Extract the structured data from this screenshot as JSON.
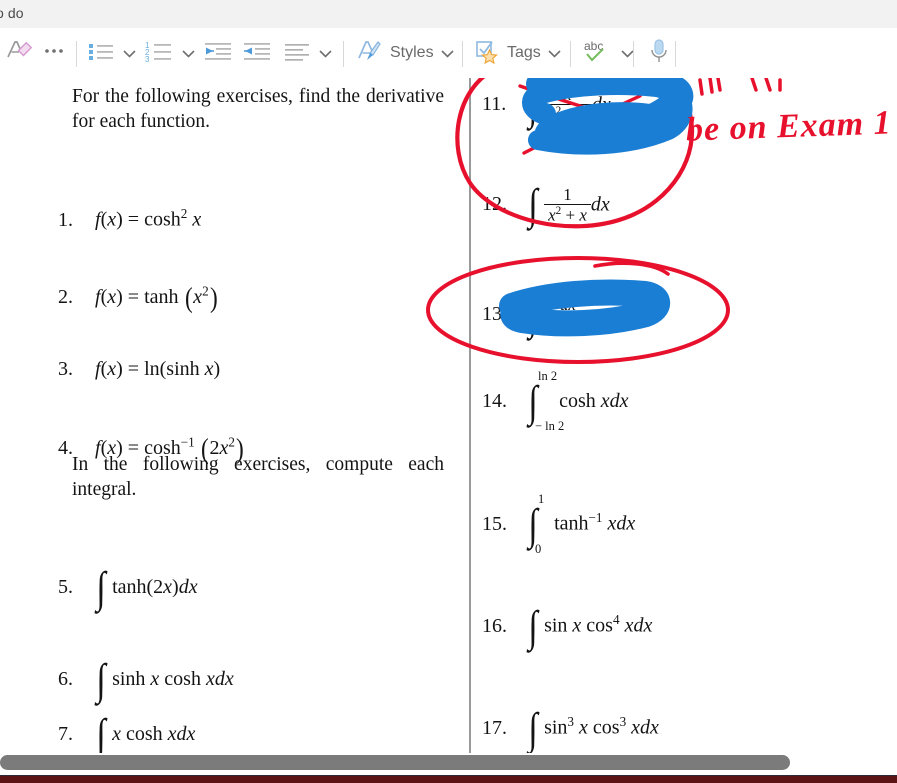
{
  "window": {
    "title": "o do"
  },
  "toolbar": {
    "items": [
      {
        "name": "clear-formatting",
        "icon": "clear-formatting-icon",
        "label": ""
      },
      {
        "name": "more-commands",
        "icon": "ellipsis-icon",
        "label": ""
      },
      {
        "name": "bullet-list",
        "icon": "bullet-list-icon",
        "label": ""
      },
      {
        "name": "numbered-list",
        "icon": "numbered-list-icon",
        "label": ""
      },
      {
        "name": "decrease-indent",
        "icon": "decrease-indent-icon",
        "label": ""
      },
      {
        "name": "increase-indent",
        "icon": "increase-indent-icon",
        "label": ""
      },
      {
        "name": "align",
        "icon": "align-icon",
        "label": ""
      },
      {
        "name": "styles",
        "icon": "styles-icon",
        "label": "Styles"
      },
      {
        "name": "tags",
        "icon": "tags-icon",
        "label": "Tags"
      },
      {
        "name": "spell-check",
        "icon": "abc-check-icon",
        "label": "abc"
      },
      {
        "name": "dictate",
        "icon": "microphone-icon",
        "label": ""
      }
    ],
    "styles_label": "Styles",
    "tags_label": "Tags",
    "spellcheck_label": "abc"
  },
  "document": {
    "left_column": {
      "intro_1": "For the following exercises, find the derivative for each function.",
      "intro_2": "In the following exercises, compute each integral.",
      "items": [
        {
          "number": "1.",
          "expr": "f(x) = cosh² x"
        },
        {
          "number": "2.",
          "expr": "f(x) = tanh (x²)"
        },
        {
          "number": "3.",
          "expr": "f(x) = ln(sinh x)"
        },
        {
          "number": "4.",
          "expr": "f(x) = cosh⁻¹ (2x²)"
        },
        {
          "number": "5.",
          "expr": "∫ tanh(2x)dx"
        },
        {
          "number": "6.",
          "expr": "∫ sinh x cosh xdx"
        },
        {
          "number": "7.",
          "expr": "∫ x cosh xdx"
        }
      ]
    },
    "right_column": {
      "items": [
        {
          "number": "11.",
          "expr": "∫ ... dx",
          "obscured": true
        },
        {
          "number": "12.",
          "expr": "∫ 1/(x² + x) dx",
          "obscured": false
        },
        {
          "number": "13.",
          "expr": "∫ ...",
          "obscured": true
        },
        {
          "number": "14.",
          "expr": "∫ from −ln 2 to ln 2 cosh xdx",
          "obscured": false
        },
        {
          "number": "15.",
          "expr": "∫ from 0 to 1 tanh⁻¹ xdx",
          "obscured": false
        },
        {
          "number": "16.",
          "expr": "∫ sin x cos⁴ xdx",
          "obscured": false
        },
        {
          "number": "17.",
          "expr": "∫ sin³ x cos³ xdx",
          "obscured": false
        }
      ],
      "math": {
        "item1_label": "1",
        "item2_label": "2",
        "item12_num": "1",
        "item12_den_x": "x",
        "item12_den_plus": "+ x",
        "item14_upper": "ln 2",
        "item14_lower": "− ln 2",
        "item14_body": "cosh xdx",
        "item15_upper": "1",
        "item15_lower": "0",
        "item15_body": "tanh",
        "item15_tail": "xdx",
        "item16_body_a": "sin x cos",
        "item16_tail": "xdx",
        "item17_body_a": "sin",
        "item17_body_b": "x cos",
        "item17_tail": "xdx"
      }
    }
  },
  "annotations": {
    "handwriting_exam": "be on Exam 1",
    "handwriting_partial_top": "will not",
    "ink_colors": {
      "red": "#e8112d",
      "blue": "#1a7ed4"
    },
    "highlight_11_note": "blue scribble over exercise 11",
    "highlight_13_note": "blue scribble over exercise 13",
    "circle_11_note": "red circle around exercise 11",
    "circle_13_note": "red ellipse around exercise 13"
  },
  "scrollbar": {
    "orientation": "horizontal",
    "thumb_label": ""
  }
}
